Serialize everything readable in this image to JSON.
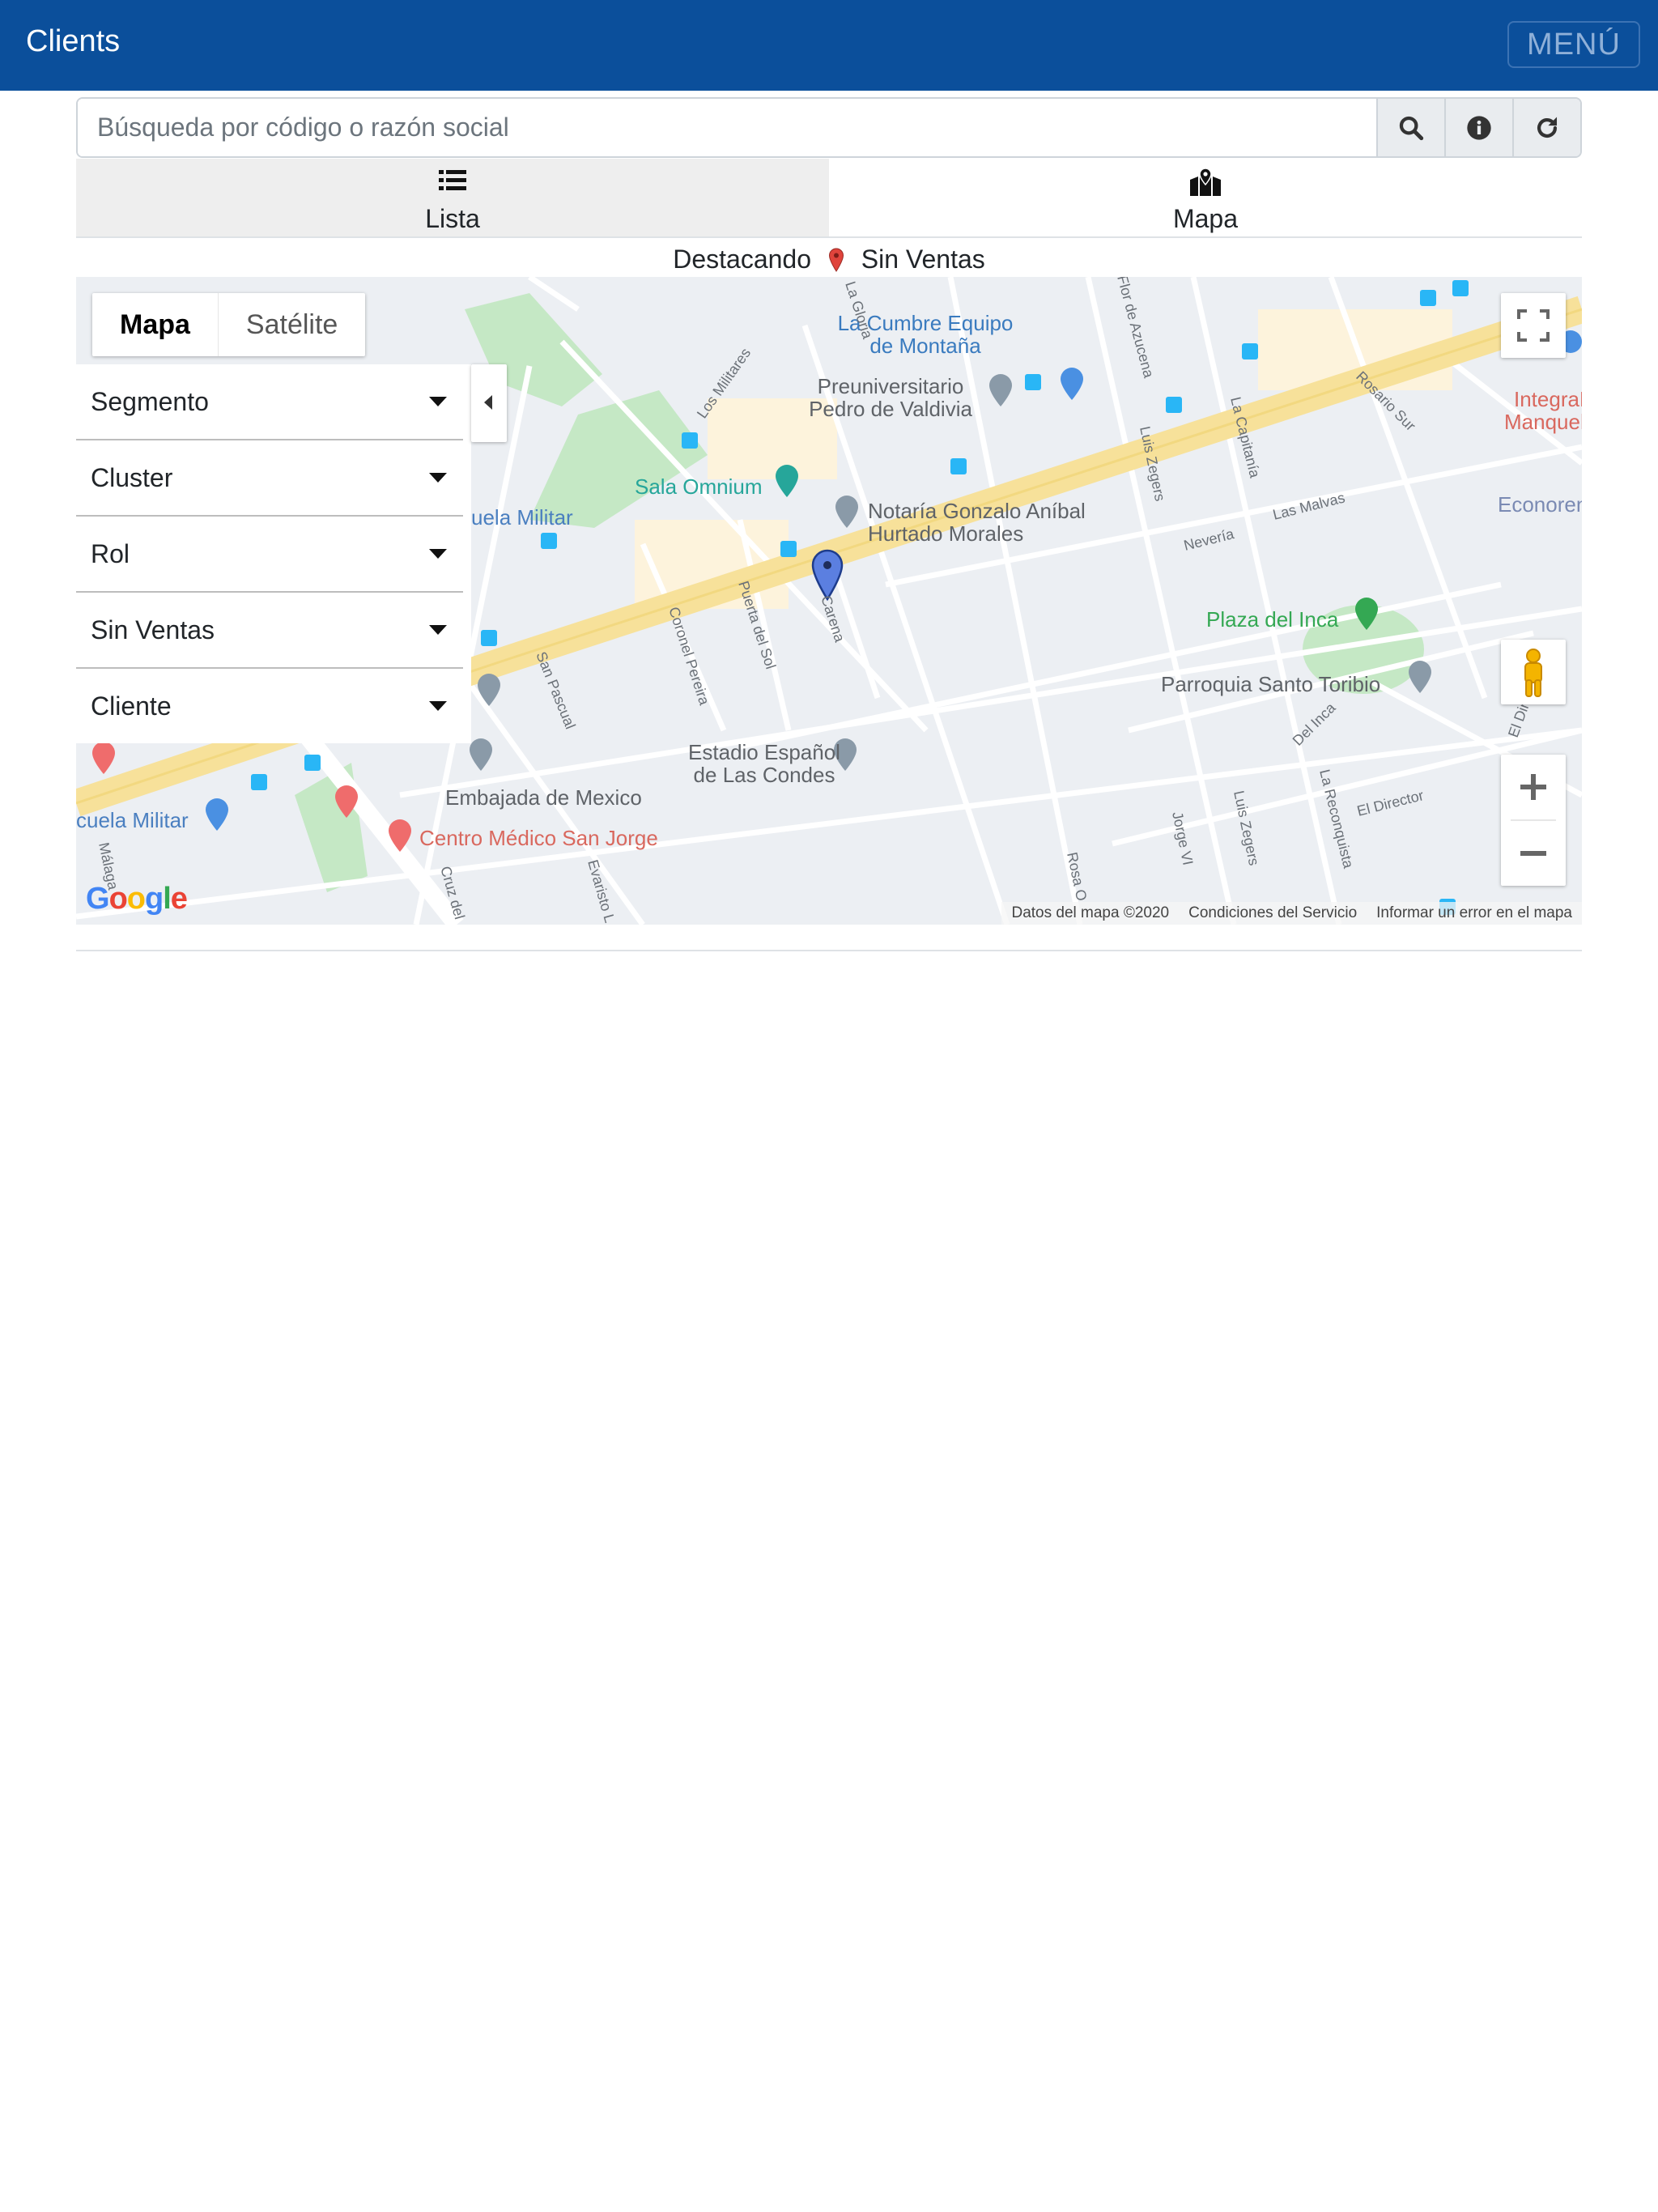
{
  "header": {
    "title": "Clients",
    "menu_label": "MENÚ"
  },
  "search": {
    "placeholder": "Búsqueda por código o razón social",
    "value": ""
  },
  "search_buttons": [
    {
      "icon": "search-icon"
    },
    {
      "icon": "info-icon"
    },
    {
      "icon": "refresh-icon"
    }
  ],
  "tabs": [
    {
      "label": "Lista",
      "icon": "list-icon",
      "active": false
    },
    {
      "label": "Mapa",
      "icon": "map-marked-icon",
      "active": true
    }
  ],
  "highlight": {
    "prefix": "Destacando",
    "label": "Sin Ventas",
    "pin_color": "#e0443c"
  },
  "map": {
    "type_buttons": {
      "map": "Mapa",
      "satellite": "Satélite",
      "selected": "Mapa"
    },
    "filters": [
      "Segmento",
      "Cluster",
      "Rol",
      "Sin Ventas",
      "Cliente"
    ],
    "marker_color": "#5b7fe0",
    "labels": {
      "la_cumbre": "La Cumbre Equipo",
      "la_cumbre2": "de Montaña",
      "preu": "Preuniversitario",
      "preu2": "Pedro de Valdivia",
      "integra": "IntegraMédica",
      "integra2": "Manquehue",
      "sala": "Sala Omnium",
      "notaria": "Notaría Gonzalo Aníbal",
      "notaria2": "Hurtado Morales",
      "econorent": "Econorent C",
      "escuela": "uela Militar",
      "escuela2": "cuela Militar",
      "plaza": "Plaza del Inca",
      "parroquia": "Parroquia Santo Toribio",
      "estadio": "Estadio Español",
      "estadio2": "de Las Condes",
      "embajada": "Embajada de Mexico",
      "centro": "Centro Médico San Jorge",
      "los_militares": "Los Militares",
      "la_gloria": "La Gloria",
      "azucena": "Flor de Azucena",
      "luis_zegers": "Luis Zegers",
      "la_capitania": "La Capitanía",
      "rosario_sur": "Rosario Sur",
      "las_malvas": "Las Malvas",
      "neveria": "Nevería",
      "coronel": "Coronel Pereira",
      "puerta_sol": "Puerta del Sol",
      "carena": "Carena",
      "san_pascual": "San Pascual",
      "del_inca": "Del Inca",
      "el_director": "El Director",
      "la_reconquista": "La Reconquista",
      "jorge_vi": "Jorge VI",
      "luis_zegers2": "Luis Zegers",
      "rosa_o": "Rosa O",
      "malaga": "Málaga",
      "cruz_del": "Cruz del",
      "evaristo": "Evaristo L",
      "el_dire": "El Dire"
    },
    "attribution": [
      "Datos del mapa ©2020",
      "Condiciones del Servicio",
      "Informar un error en el mapa"
    ],
    "google_logo": "Google"
  }
}
